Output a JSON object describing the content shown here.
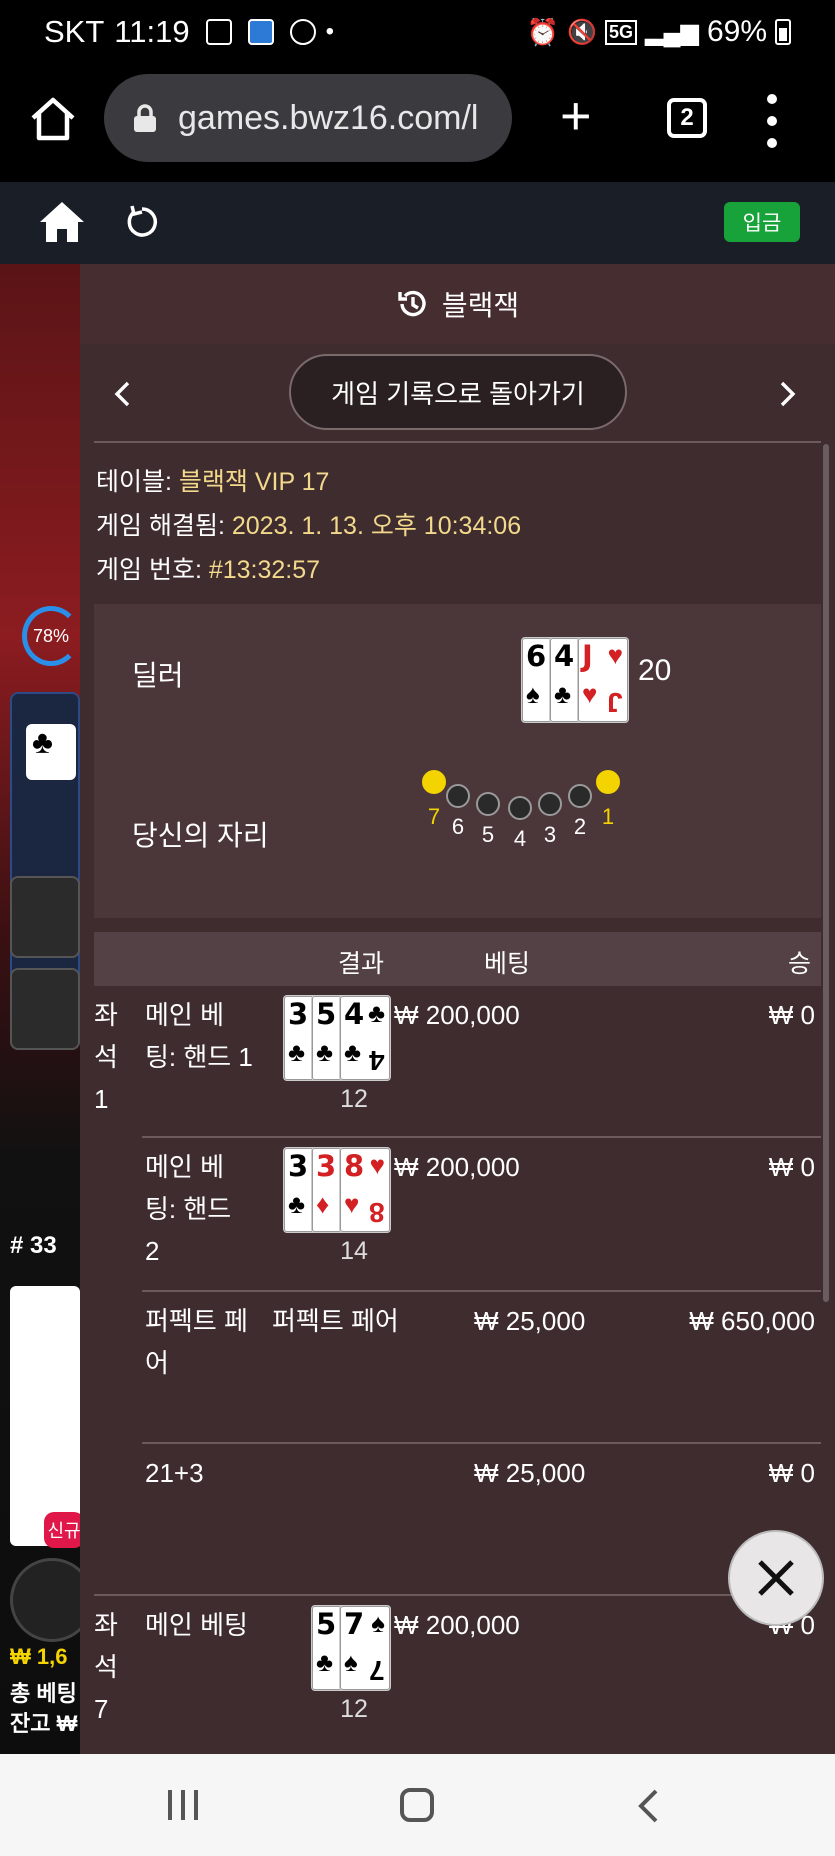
{
  "status": {
    "time": "11:19",
    "carrier": "SKT",
    "battery": "69%",
    "network": "5G"
  },
  "browser": {
    "url": "games.bwz16.com/l",
    "tab_count": "2"
  },
  "gamebar": {
    "deposit_label": "입금"
  },
  "panel": {
    "title": "블랙잭",
    "back_label": "게임 기록으로 돌아가기",
    "info": {
      "table_label": "테이블: ",
      "table_value": "블랙잭 VIP 17",
      "resolved_label": "게임 해결됨: ",
      "resolved_value": "2023. 1. 13. 오후 10:34:06",
      "game_no_label": "게임 번호: ",
      "game_no_value": "#13:32:57"
    },
    "dealer": {
      "label": "딜러",
      "total": "20",
      "cards": [
        {
          "rank": "6",
          "suit": "♠",
          "color": "black"
        },
        {
          "rank": "4",
          "suit": "♣",
          "color": "black"
        },
        {
          "rank": "J",
          "suit": "♥",
          "color": "red"
        }
      ]
    },
    "seats": {
      "label": "당신의 자리",
      "numbers": [
        "7",
        "6",
        "5",
        "4",
        "3",
        "2",
        "1"
      ],
      "active": [
        "7",
        "1"
      ]
    },
    "table_header": {
      "result": "결과",
      "bet": "베팅",
      "win": "승"
    },
    "rows": [
      {
        "seat": "좌\n석\n1",
        "bet_type": "메인 베\n팅: 핸드 1",
        "result": "",
        "total": "12",
        "amount": "₩ 200,000",
        "win": "₩ 0",
        "cards": [
          {
            "rank": "3",
            "suit": "♣",
            "color": "black"
          },
          {
            "rank": "5",
            "suit": "♣",
            "color": "black"
          },
          {
            "rank": "4",
            "suit": "♣",
            "color": "black"
          }
        ]
      },
      {
        "seat": "",
        "bet_type": "메인 베\n팅: 핸드\n2",
        "result": "",
        "total": "14",
        "amount": "₩ 200,000",
        "win": "₩ 0",
        "cards": [
          {
            "rank": "3",
            "suit": "♣",
            "color": "black"
          },
          {
            "rank": "3",
            "suit": "♦",
            "color": "red"
          },
          {
            "rank": "8",
            "suit": "♥",
            "color": "red"
          }
        ]
      },
      {
        "seat": "",
        "bet_type": "퍼펙트 페\n어",
        "result": "퍼펙트 페어",
        "total": "",
        "amount": "₩ 25,000",
        "win": "₩ 650,000",
        "cards": []
      },
      {
        "seat": "",
        "bet_type": "21+3",
        "result": "",
        "total": "",
        "amount": "₩ 25,000",
        "win": "₩ 0",
        "cards": []
      },
      {
        "seat": "좌\n석\n7",
        "bet_type": "메인 베팅",
        "result": "",
        "total": "12",
        "amount": "₩ 200,000",
        "win": "₩ 0",
        "cards": [
          {
            "rank": "5",
            "suit": "♣",
            "color": "black"
          },
          {
            "rank": "7",
            "suit": "♠",
            "color": "black"
          }
        ]
      }
    ]
  },
  "background": {
    "progress": "78%",
    "round": "# 33",
    "new_badge": "신규",
    "balance_line": "₩ 1,6",
    "total_bet": "총 베팅",
    "balance_label": "잔고 ₩"
  }
}
